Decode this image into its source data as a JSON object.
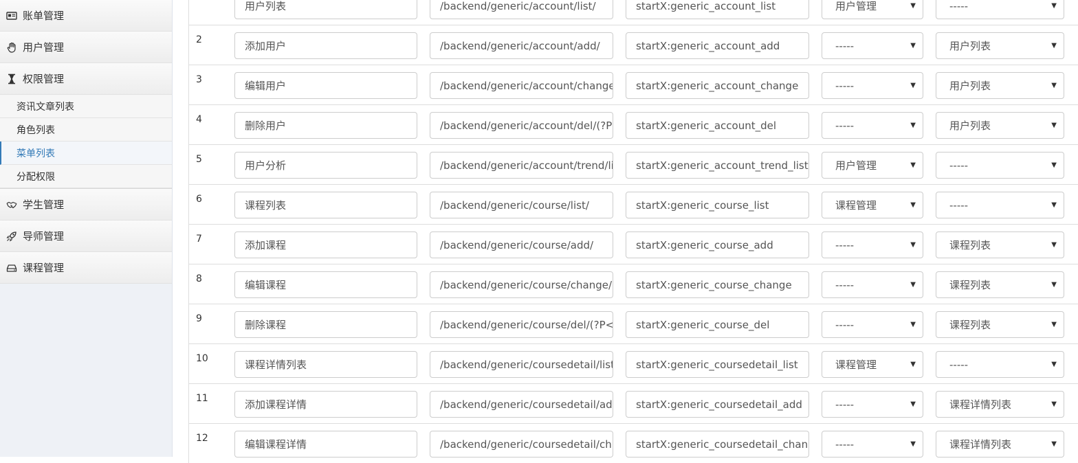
{
  "sidebar": {
    "groups": [
      {
        "label": "账单管理",
        "icon": "id-card-icon"
      },
      {
        "label": "用户管理",
        "icon": "hand-icon"
      },
      {
        "label": "权限管理",
        "icon": "hourglass-icon"
      },
      {
        "label": "学生管理",
        "icon": "handshake-icon"
      },
      {
        "label": "导师管理",
        "icon": "rocket-icon"
      },
      {
        "label": "课程管理",
        "icon": "drive-icon"
      }
    ],
    "sub_items": [
      {
        "label": "资讯文章列表",
        "active": false
      },
      {
        "label": "角色列表",
        "active": false
      },
      {
        "label": "菜单列表",
        "active": true
      },
      {
        "label": "分配权限",
        "active": false
      }
    ]
  },
  "dropdown_arrow": "▼",
  "colors": {
    "accent": "#337ab7",
    "sidebar_bg": "#eef1f6",
    "border": "#cccccc"
  },
  "rows": [
    {
      "num": "",
      "title": "用户列表",
      "url": "/backend/generic/account/list/",
      "name": "startX:generic_account_list",
      "menu": "用户管理",
      "parent": "-----"
    },
    {
      "num": "2",
      "title": "添加用户",
      "url": "/backend/generic/account/add/",
      "name": "startX:generic_account_add",
      "menu": "-----",
      "parent": "用户列表"
    },
    {
      "num": "3",
      "title": "编辑用户",
      "url": "/backend/generic/account/change",
      "name": "startX:generic_account_change",
      "menu": "-----",
      "parent": "用户列表"
    },
    {
      "num": "4",
      "title": "删除用户",
      "url": "/backend/generic/account/del/(?P",
      "name": "startX:generic_account_del",
      "menu": "-----",
      "parent": "用户列表"
    },
    {
      "num": "5",
      "title": "用户分析",
      "url": "/backend/generic/account/trend/li",
      "name": "startX:generic_account_trend_list",
      "menu": "用户管理",
      "parent": "-----"
    },
    {
      "num": "6",
      "title": "课程列表",
      "url": "/backend/generic/course/list/",
      "name": "startX:generic_course_list",
      "menu": "课程管理",
      "parent": "-----"
    },
    {
      "num": "7",
      "title": "添加课程",
      "url": "/backend/generic/course/add/",
      "name": "startX:generic_course_add",
      "menu": "-----",
      "parent": "课程列表"
    },
    {
      "num": "8",
      "title": "编辑课程",
      "url": "/backend/generic/course/change/",
      "name": "startX:generic_course_change",
      "menu": "-----",
      "parent": "课程列表"
    },
    {
      "num": "9",
      "title": "删除课程",
      "url": "/backend/generic/course/del/(?P<",
      "name": "startX:generic_course_del",
      "menu": "-----",
      "parent": "课程列表"
    },
    {
      "num": "10",
      "title": "课程详情列表",
      "url": "/backend/generic/coursedetail/list",
      "name": "startX:generic_coursedetail_list",
      "menu": "课程管理",
      "parent": "-----"
    },
    {
      "num": "11",
      "title": "添加课程详情",
      "url": "/backend/generic/coursedetail/ad",
      "name": "startX:generic_coursedetail_add",
      "menu": "-----",
      "parent": "课程详情列表"
    },
    {
      "num": "12",
      "title": "编辑课程详情",
      "url": "/backend/generic/coursedetail/ch",
      "name": "startX:generic_coursedetail_chan",
      "menu": "-----",
      "parent": "课程详情列表"
    }
  ]
}
